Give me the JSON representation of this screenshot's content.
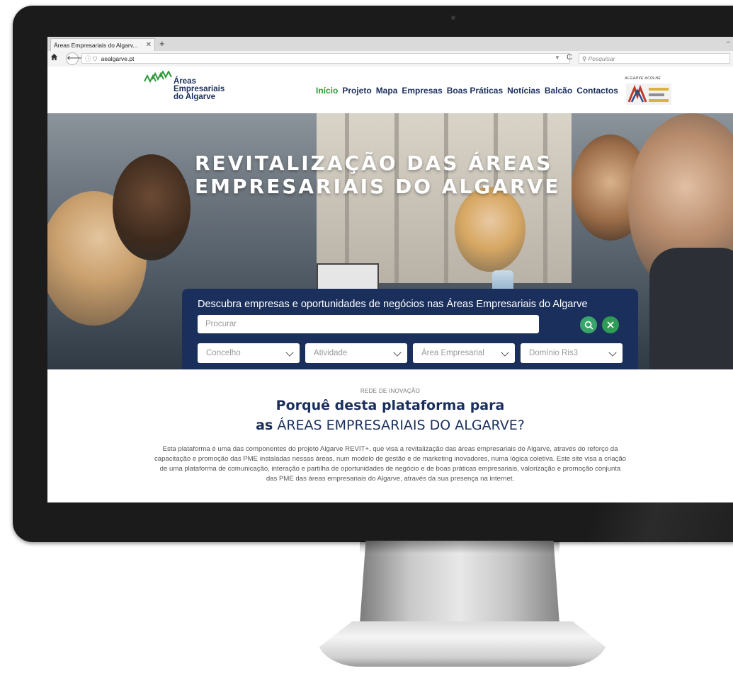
{
  "browser": {
    "tab_title": "Áreas Empresariais do Algarv...",
    "url": "aealgarve.pt",
    "search_placeholder": "Pesquisar"
  },
  "site": {
    "logo_text": [
      "Áreas",
      "Empresariais",
      "do Algarve"
    ],
    "nav": [
      "Início",
      "Projeto",
      "Mapa",
      "Empresas",
      "Boas Práticas",
      "Notícias",
      "Balcão",
      "Contactos"
    ],
    "active_nav": "Início",
    "partner_label": "ALGARVE ACOLHE"
  },
  "hero": {
    "title_line1": "REVITALIZAÇÃO DAS ÁREAS",
    "title_line2": "EMPRESARIAIS DO ALGARVE"
  },
  "search": {
    "heading": "Descubra empresas e oportunidades de negócios nas Áreas Empresariais do Algarve",
    "input_placeholder": "Procurar",
    "filters": [
      "Concelho",
      "Atividade",
      "Área Empresarial",
      "Domínio Ris3"
    ]
  },
  "section": {
    "kicker": "REDE DE INOVAÇÃO",
    "headline_line1": "Porquê desta plataforma para",
    "headline_line2_strong": "as",
    "headline_line2_rest": " ÁREAS EMPRESARIAIS DO ALGARVE?",
    "body": "Esta plataforma é uma das componentes do projeto Algarve REVIT+, que visa a revitalização das áreas empresariais do Algarve, através do reforço da capacitação e promoção das PME instaladas nessas áreas, num modelo de gestão e de marketing inovadores, numa lógica coletiva. Este site visa a criação de uma plataforma de comunicação, interação e partilha de oportunidades de negócio e de boas práticas empresariais, valorização e promoção conjunta das PME das áreas empresariais do Algarve, através da sua presença na internet."
  },
  "colors": {
    "navy": "#1b2f5c",
    "green": "#2e9a3d"
  }
}
